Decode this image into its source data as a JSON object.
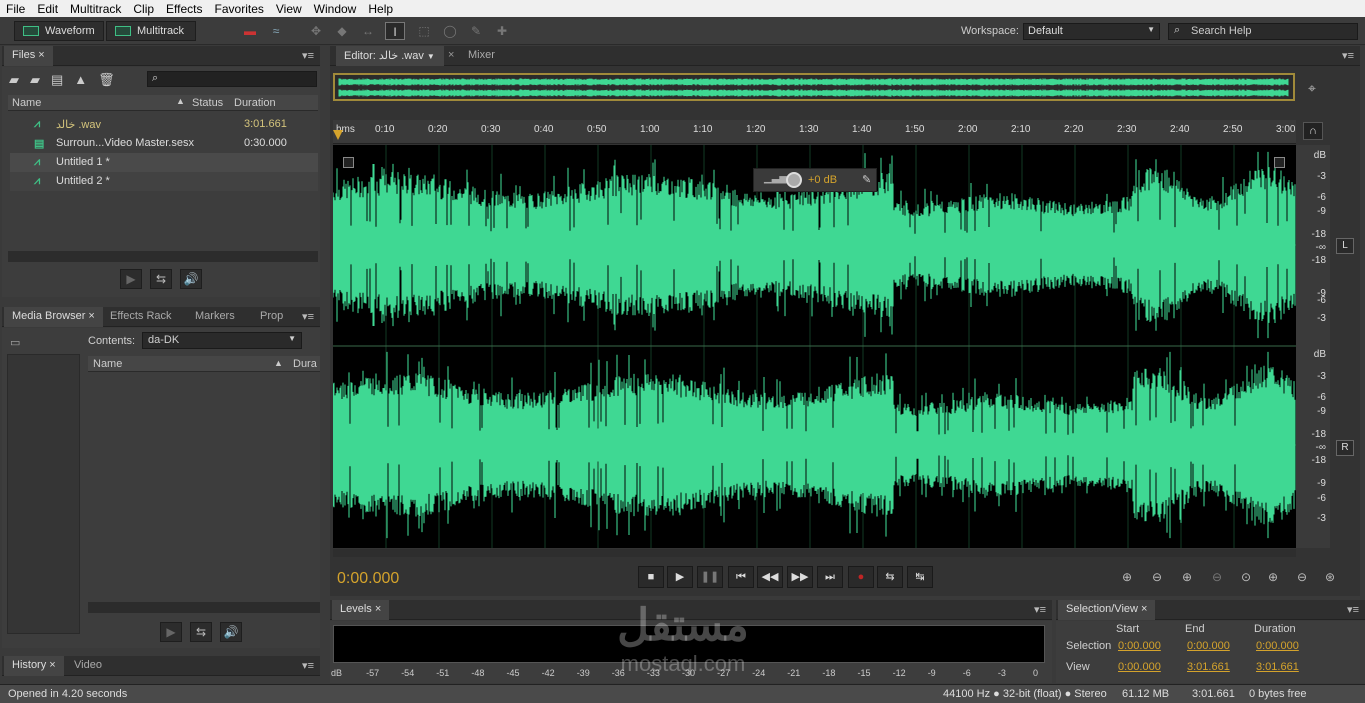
{
  "menu": [
    "File",
    "Edit",
    "Multitrack",
    "Clip",
    "Effects",
    "Favorites",
    "View",
    "Window",
    "Help"
  ],
  "toolbar": {
    "waveform_label": "Waveform",
    "multitrack_label": "Multitrack",
    "workspace_label": "Workspace:",
    "workspace_value": "Default",
    "search_placeholder": "Search Help"
  },
  "files_panel": {
    "tab": "Files",
    "columns": {
      "name": "Name",
      "status": "Status",
      "duration": "Duration"
    },
    "items": [
      {
        "name": "خالد .wav",
        "duration": "3:01.661"
      },
      {
        "name": "Surroun...Video Master.sesx",
        "duration": "0:30.000"
      },
      {
        "name": "Untitled 1 *",
        "duration": ""
      },
      {
        "name": "Untitled 2 *",
        "duration": ""
      }
    ]
  },
  "media_panel": {
    "tabs": [
      "Media Browser",
      "Effects Rack",
      "Markers",
      "Prop"
    ],
    "contents_label": "Contents:",
    "contents_value": "da-DK",
    "col_name": "Name",
    "col_dur": "Dura"
  },
  "history_panel": {
    "tabs": [
      "History",
      "Video"
    ]
  },
  "editor": {
    "tabs": [
      "Editor: خالد .wav",
      "Mixer"
    ],
    "ruler": [
      "hms",
      "0:10",
      "0:20",
      "0:30",
      "0:40",
      "0:50",
      "1:00",
      "1:10",
      "1:20",
      "1:30",
      "1:40",
      "1:50",
      "2:00",
      "2:10",
      "2:20",
      "2:30",
      "2:40",
      "2:50",
      "3:00"
    ],
    "db_top": [
      "dB",
      "-3",
      "-6",
      "-9",
      "-18",
      "-∞",
      "-18",
      "-9",
      "-6",
      "-3"
    ],
    "db_bottom": [
      "dB",
      "-3",
      "-6",
      "-9",
      "-18",
      "-∞",
      "-18",
      "-9",
      "-6",
      "-3"
    ],
    "channel_left": "L",
    "channel_right": "R",
    "hud_gain": "+0 dB",
    "timecode": "0:00.000",
    "wave_color": "#3fd893"
  },
  "levels_panel": {
    "tab": "Levels",
    "scale": [
      "dB",
      "-57",
      "-54",
      "-51",
      "-48",
      "-45",
      "-42",
      "-39",
      "-36",
      "-33",
      "-30",
      "-27",
      "-24",
      "-21",
      "-18",
      "-15",
      "-12",
      "-9",
      "-6",
      "-3",
      "0"
    ]
  },
  "selection_view": {
    "tab": "Selection/View",
    "headers": {
      "start": "Start",
      "end": "End",
      "duration": "Duration"
    },
    "selection": {
      "label": "Selection",
      "start": "0:00.000",
      "end": "0:00.000",
      "duration": "0:00.000"
    },
    "view": {
      "label": "View",
      "start": "0:00.000",
      "end": "3:01.661",
      "duration": "3:01.661"
    }
  },
  "status": {
    "message": "Opened in 4.20 seconds",
    "format": "44100 Hz ● 32-bit (float) ● Stereo",
    "size": "61.12 MB",
    "length": "3:01.661",
    "free": "0  bytes free"
  },
  "watermark": {
    "arabic": "مستقل",
    "latin": "mostaql.com"
  }
}
